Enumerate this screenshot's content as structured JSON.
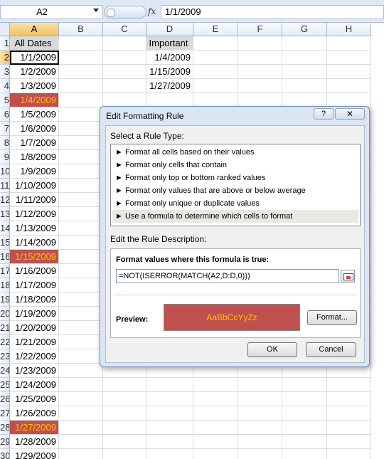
{
  "formula_bar": {
    "name_box": "A2",
    "fx_label": "fx",
    "formula": "1/1/2009"
  },
  "columns": [
    "A",
    "B",
    "C",
    "D",
    "E",
    "F",
    "G",
    "H"
  ],
  "rows": [
    "1",
    "2",
    "3",
    "4",
    "5",
    "6",
    "7",
    "8",
    "9",
    "10",
    "11",
    "12",
    "13",
    "14",
    "15",
    "16",
    "17",
    "18",
    "19",
    "20",
    "21",
    "22",
    "23",
    "24",
    "25",
    "26",
    "27",
    "28",
    "29",
    "30"
  ],
  "cells": {
    "a1": "All Dates",
    "d1": "Important",
    "a_values": [
      "1/1/2009",
      "1/2/2009",
      "1/3/2009",
      "1/4/2009",
      "1/5/2009",
      "1/6/2009",
      "1/7/2009",
      "1/8/2009",
      "1/9/2009",
      "1/10/2009",
      "1/11/2009",
      "1/12/2009",
      "1/13/2009",
      "1/14/2009",
      "1/15/2009",
      "1/16/2009",
      "1/17/2009",
      "1/18/2009",
      "1/19/2009",
      "1/20/2009",
      "1/21/2009",
      "1/22/2009",
      "1/23/2009",
      "1/24/2009",
      "1/25/2009",
      "1/26/2009",
      "1/27/2009",
      "1/28/2009",
      "1/29/2009"
    ],
    "d_values": [
      "1/4/2009",
      "1/15/2009",
      "1/27/2009"
    ]
  },
  "colors": {
    "highlight_fill": "#c0504d",
    "highlight_text": "#ffc000"
  },
  "dialog": {
    "title": "Edit Formatting Rule",
    "help": "?",
    "close": "✕",
    "select_rule_label": "Select a Rule Type:",
    "rule_types": [
      "► Format all cells based on their values",
      "► Format only cells that contain",
      "► Format only top or bottom ranked values",
      "► Format only values that are above or below average",
      "► Format only unique or duplicate values",
      "► Use a formula to determine which cells to format"
    ],
    "edit_desc_label": "Edit the Rule Description:",
    "formula_heading": "Format values where this formula is true:",
    "formula_value": "=NOT(ISERROR(MATCH(A2,D:D,0)))",
    "preview_label": "Preview:",
    "preview_sample": "AaBbCcYyZz",
    "format_button": "Format...",
    "ok_button": "OK",
    "cancel_button": "Cancel"
  }
}
